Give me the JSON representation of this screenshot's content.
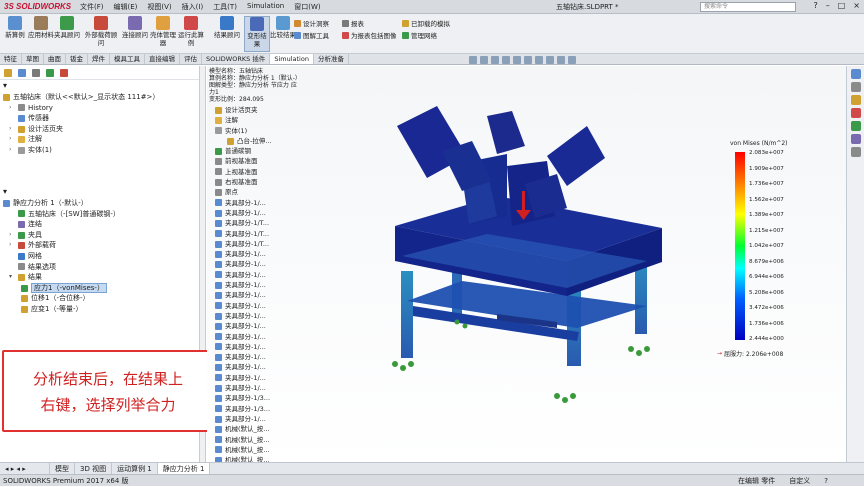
{
  "app": {
    "logo": "3S SOLIDWORKS",
    "menu": [
      "文件(F)",
      "编辑(E)",
      "视图(V)",
      "插入(I)",
      "工具(T)",
      "Simulation",
      "窗口(W)"
    ],
    "doc_title": "五轴钻床.SLDPRT *",
    "search_placeholder": "搜索命令",
    "win_controls": [
      "?",
      "–",
      "□",
      "×"
    ]
  },
  "ribbon": {
    "big": [
      "新算例",
      "应用材料",
      "夹具顾问",
      "外部载荷顾问",
      "连接顾问",
      "壳体管理器",
      "运行此算例",
      "结果顾问",
      "变形结果",
      "比较结果"
    ],
    "small_a": [
      "设计洞察",
      "图解工具"
    ],
    "small_b": [
      "报表",
      "为报表包括图像"
    ],
    "small_c": [
      "已卸载的模拟",
      "管理网络"
    ]
  },
  "tabs": [
    "特征",
    "草图",
    "曲面",
    "钣金",
    "焊件",
    "模具工具",
    "直接编辑",
    "评估",
    "SOLIDWORKS 插件",
    "Simulation",
    "分析准备"
  ],
  "feature_tree": {
    "root": "五轴钻床（默认<<默认>_显示状态 111#>）",
    "items": [
      "History",
      "传感器",
      "设计活页夹",
      "注解",
      "实体(1)"
    ]
  },
  "sim_tree": {
    "root": "静应力分析 1（-默认-）",
    "items": [
      "五轴钻床（-[SW]普通碳钢-）",
      "连结",
      "夹具",
      "外部载荷",
      "网格",
      "结果选项",
      "结果"
    ],
    "results": [
      "应力1（-vonMises-）",
      "位移1（-合位移-）",
      "应变1（-等量-）"
    ]
  },
  "annotation": {
    "line1": "分析结束后，在结果上",
    "line2": "右键，选择列举合力"
  },
  "viewport_tree": {
    "header": [
      "模型名称：五轴钻床",
      "算例名称：静应力分析 1（默认-）",
      "图解类型：静应力分析 节应力 应力1",
      "变形比例：284.095"
    ],
    "items": [
      "设计活页夹",
      "注解",
      "实体(1)",
      "凸台-拉伸...",
      "普通碳钢",
      "前视基准面",
      "上视基准面",
      "右视基准面",
      "原点",
      "夹具部分-1/...",
      "夹具部分-1/...",
      "夹具部分-1/T...",
      "夹具部分-1/T...",
      "夹具部分-1/T...",
      "夹具部分-1/...",
      "夹具部分-1/...",
      "夹具部分-1/...",
      "夹具部分-1/...",
      "夹具部分-1/...",
      "夹具部分-1/...",
      "夹具部分-1/...",
      "夹具部分-1/...",
      "夹具部分-1/...",
      "夹具部分-1/...",
      "夹具部分-1/...",
      "夹具部分-1/...",
      "夹具部分-1/...",
      "夹具部分-1/...",
      "夹具部分-1/3...",
      "夹具部分-1/3...",
      "夹具部分-1/...",
      "机械(默认_按...",
      "机械(默认_按...",
      "机械(默认_按...",
      "机械(默认_按...",
      "夹具部分-1/...",
      "夹具部分-1/..."
    ]
  },
  "legend": {
    "title": "von Mises (N/m^2)",
    "ticks": [
      "2.083e+007",
      "1.909e+007",
      "1.736e+007",
      "1.562e+007",
      "1.389e+007",
      "1.215e+007",
      "1.042e+007",
      "8.679e+006",
      "6.944e+006",
      "5.208e+006",
      "3.472e+006",
      "1.736e+006",
      "2.444e+000"
    ],
    "yield": "屈服力: 2.206e+008"
  },
  "bottom_tabs": [
    "模型",
    "3D 视图",
    "运动算例 1",
    "静应力分析 1"
  ],
  "status": {
    "left": "SOLIDWORKS Premium 2017 x64 版",
    "right": [
      "在编辑 零件",
      "自定义",
      "?"
    ]
  },
  "colors": {
    "accent": "#c8102e",
    "mesh_blue": "#1a2f9a",
    "annotation_red": "#e03030"
  }
}
